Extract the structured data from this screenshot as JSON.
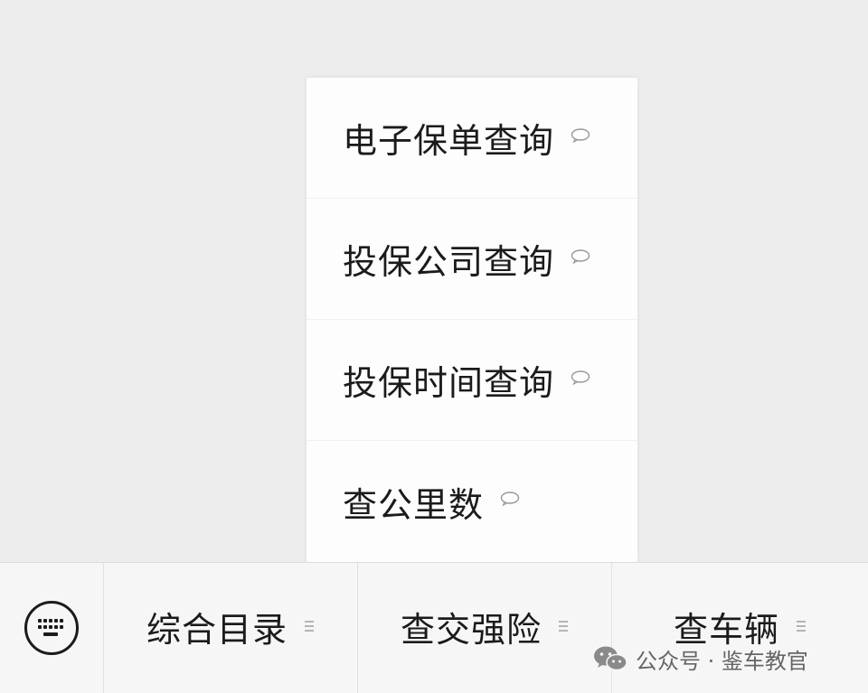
{
  "submenu": {
    "items": [
      {
        "label": "电子保单查询"
      },
      {
        "label": "投保公司查询"
      },
      {
        "label": "投保时间查询"
      },
      {
        "label": "查公里数"
      }
    ]
  },
  "menubar": {
    "keyboard_icon": "keyboard-icon",
    "buttons": [
      {
        "label": "综合目录"
      },
      {
        "label": "查交强险"
      },
      {
        "label": "查车辆"
      }
    ]
  },
  "watermark": {
    "text": "公众号 · 鉴车教官",
    "icon": "wechat-icon"
  },
  "colors": {
    "background": "#ededee",
    "menu_bg": "#fdfdfd",
    "text": "#1b1b1b"
  }
}
